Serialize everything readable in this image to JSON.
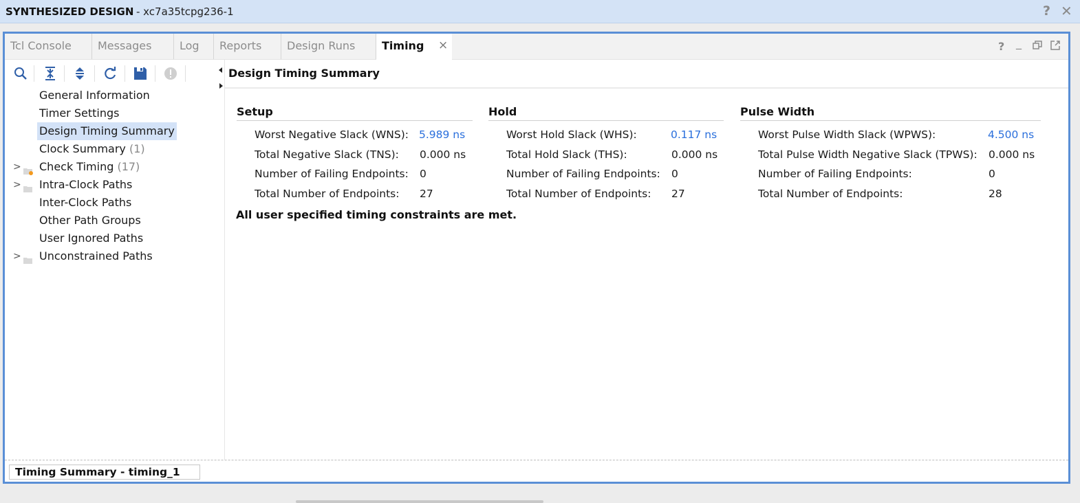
{
  "window": {
    "title": "SYNTHESIZED DESIGN",
    "subtitle": "- xc7a35tcpg236-1",
    "help_glyph": "?",
    "close_glyph": "✕"
  },
  "tabs": [
    {
      "label": "Tcl Console"
    },
    {
      "label": "Messages"
    },
    {
      "label": "Log"
    },
    {
      "label": "Reports"
    },
    {
      "label": "Design Runs"
    },
    {
      "label": "Timing",
      "active": true,
      "close": "×"
    }
  ],
  "panel_controls": {
    "help": "?",
    "minimize": "_",
    "restore": "🗗",
    "float": "⇱"
  },
  "toolbar": {
    "icons": [
      "search-icon",
      "collapse-all-icon",
      "expand-all-icon",
      "refresh-icon",
      "save-icon",
      "info-icon"
    ]
  },
  "tree": {
    "items": [
      {
        "label": "General Information",
        "count": ""
      },
      {
        "label": "Timer Settings",
        "count": ""
      },
      {
        "label": "Design Timing Summary",
        "count": "",
        "selected": true
      },
      {
        "label": "Clock Summary",
        "count": "(1)"
      },
      {
        "label": "Check Timing",
        "count": "(17)",
        "expandable": true
      },
      {
        "label": "Intra-Clock Paths",
        "count": "",
        "expandable": true
      },
      {
        "label": "Inter-Clock Paths",
        "count": ""
      },
      {
        "label": "Other Path Groups",
        "count": ""
      },
      {
        "label": "User Ignored Paths",
        "count": ""
      },
      {
        "label": "Unconstrained Paths",
        "count": "",
        "expandable": true
      }
    ],
    "expand_glyph": ">"
  },
  "content": {
    "title": "Design Timing Summary",
    "setup": {
      "title": "Setup",
      "rows": [
        {
          "label": "Worst Negative Slack (WNS):",
          "value": "5.989 ns",
          "link": true
        },
        {
          "label": "Total Negative Slack (TNS):",
          "value": "0.000 ns"
        },
        {
          "label": "Number of Failing Endpoints:",
          "value": "0"
        },
        {
          "label": "Total Number of Endpoints:",
          "value": "27"
        }
      ]
    },
    "hold": {
      "title": "Hold",
      "rows": [
        {
          "label": "Worst Hold Slack (WHS):",
          "value": "0.117 ns",
          "link": true
        },
        {
          "label": "Total Hold Slack (THS):",
          "value": "0.000 ns"
        },
        {
          "label": "Number of Failing Endpoints:",
          "value": "0"
        },
        {
          "label": "Total Number of Endpoints:",
          "value": "27"
        }
      ]
    },
    "pulse": {
      "title": "Pulse Width",
      "rows": [
        {
          "label": "Worst Pulse Width Slack (WPWS):",
          "value": "4.500 ns",
          "link": true
        },
        {
          "label": "Total Pulse Width Negative Slack (TPWS):",
          "value": "0.000 ns"
        },
        {
          "label": "Number of Failing Endpoints:",
          "value": "0"
        },
        {
          "label": "Total Number of Endpoints:",
          "value": "28"
        }
      ]
    },
    "status_message": "All user specified timing constraints are met."
  },
  "footer": {
    "report_name": "Timing Summary - timing_1"
  },
  "colors": {
    "link": "#2a6fdc",
    "frame_border": "#5a8fd6",
    "titlebar_bg": "#d4e3f6",
    "selection_bg": "#d3e2f7"
  }
}
